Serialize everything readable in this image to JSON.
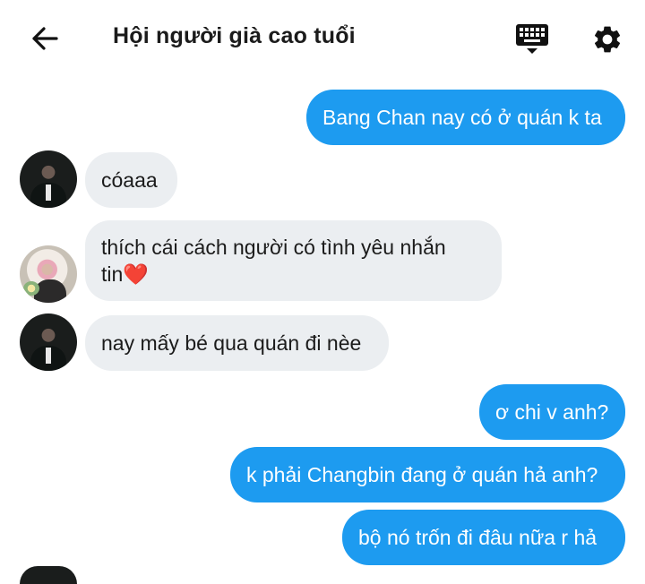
{
  "header": {
    "title": "Hội người già cao tuổi",
    "icons": {
      "back": "arrow-left-icon",
      "keyboard": "keyboard-icon",
      "settings": "gear-icon"
    }
  },
  "messages": [
    {
      "direction": "out",
      "text": "Bang Chan nay có ở quán k ta"
    },
    {
      "direction": "in",
      "avatar": "avatar-dark",
      "text": "cóaaa"
    },
    {
      "direction": "in",
      "avatar": "avatar-light",
      "line1": "thích cái cách người có tình yêu nhắn",
      "line2": "tin",
      "emoji": "❤️"
    },
    {
      "direction": "in",
      "avatar": "avatar-dark",
      "text": "nay mấy bé qua quán đi nèe"
    },
    {
      "direction": "out",
      "text": "ơ chi v anh?"
    },
    {
      "direction": "out",
      "text": "k phải Changbin đang ở quán hả anh?"
    },
    {
      "direction": "out",
      "text": "bộ nó trốn đi đâu nữa r hả"
    }
  ],
  "colors": {
    "outgoing_bubble": "#1d9bf0",
    "incoming_bubble": "#ebeef1",
    "background": "#ffffff"
  }
}
